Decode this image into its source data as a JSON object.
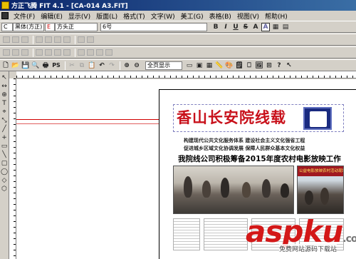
{
  "window": {
    "title": "方正飞腾 FIT 4.1 - [CA-014 A3.FIT]"
  },
  "menu": [
    "文件(F)",
    "编辑(E)",
    "显示(V)",
    "版面(L)",
    "格式(T)",
    "文字(W)",
    "美工(G)",
    "表格(B)",
    "视图(V)",
    "帮助(H)"
  ],
  "font_toolbar": {
    "cn_prefix": "C",
    "cn_font": "黑体(方正)",
    "en_prefix": "E",
    "en_font": "方头正",
    "size": "6号",
    "buttons": [
      "B",
      "I",
      "U",
      "S",
      "A",
      "A"
    ]
  },
  "main_toolbar": {
    "zoom": "全页显示",
    "ps_label": "PS"
  },
  "left_tools": [
    "↖",
    "↔",
    "⊕",
    "T",
    "⌖",
    "⤡",
    "╱",
    "+",
    "▭",
    "╲",
    "▢",
    "◯",
    "◇",
    "⬡"
  ],
  "document": {
    "masthead": "香山长安院线载",
    "sub_line1": "构建现代公共文化服务体系 建设社会主义文化强省工程",
    "sub_line2": "促进城乡区域文化协调发展 保障人民群众基本文化权益",
    "headline": "我院线公司积极筹备2015年度农村电影放映工作",
    "banner": "公益电影放映农村活动现场"
  },
  "watermark": {
    "brand": "aspku",
    "suffix": ".com",
    "sub": "免费网站源码下载站"
  }
}
